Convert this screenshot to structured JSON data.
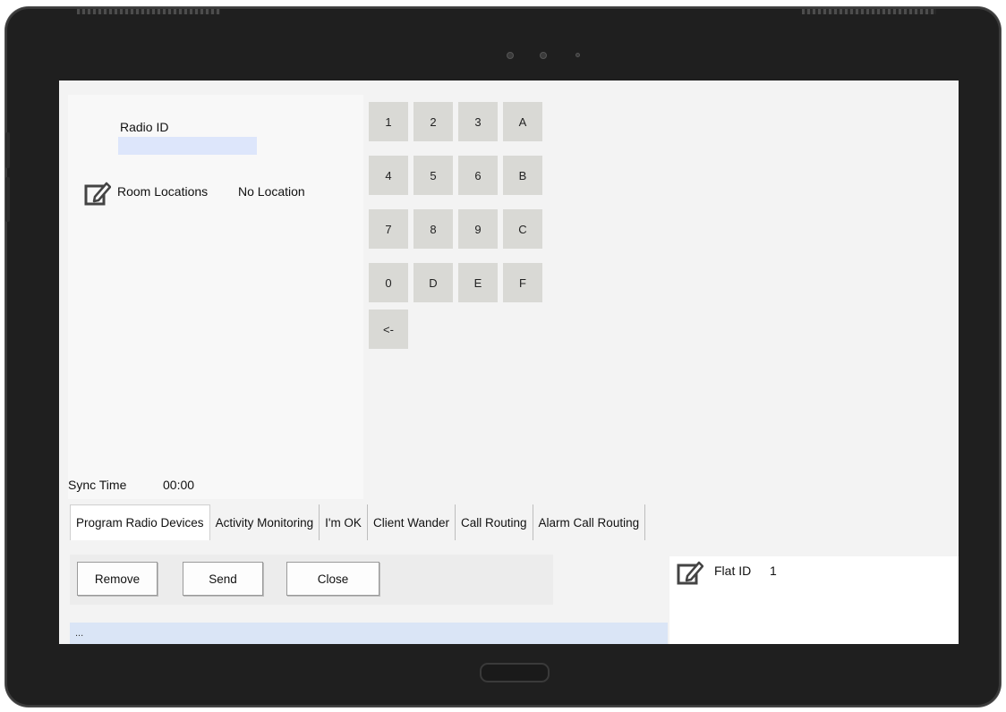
{
  "radio": {
    "id_label": "Radio ID",
    "id_value": ""
  },
  "room": {
    "label": "Room Locations",
    "value": "No Location"
  },
  "sync": {
    "label": "Sync Time",
    "value": "00:00"
  },
  "keypad": {
    "keys": [
      "1",
      "2",
      "3",
      "A",
      "4",
      "5",
      "6",
      "B",
      "7",
      "8",
      "9",
      "C",
      "0",
      "D",
      "E",
      "F",
      "<-"
    ]
  },
  "tabs": [
    {
      "label": "Program Radio Devices"
    },
    {
      "label": "Activity Monitoring"
    },
    {
      "label": "I'm OK"
    },
    {
      "label": "Client Wander"
    },
    {
      "label": "Call Routing"
    },
    {
      "label": "Alarm Call Routing"
    }
  ],
  "buttons": {
    "remove": "Remove",
    "send": "Send",
    "close": "Close"
  },
  "status": {
    "text": "..."
  },
  "flat": {
    "label": "Flat ID",
    "value": "1"
  },
  "icons": {
    "edit": "edit-icon"
  },
  "colors": {
    "input_bg": "#dde6fb",
    "key_bg": "#d9d9d5",
    "status_bg": "#dae5f6",
    "bezel": "#1f1f1f"
  }
}
